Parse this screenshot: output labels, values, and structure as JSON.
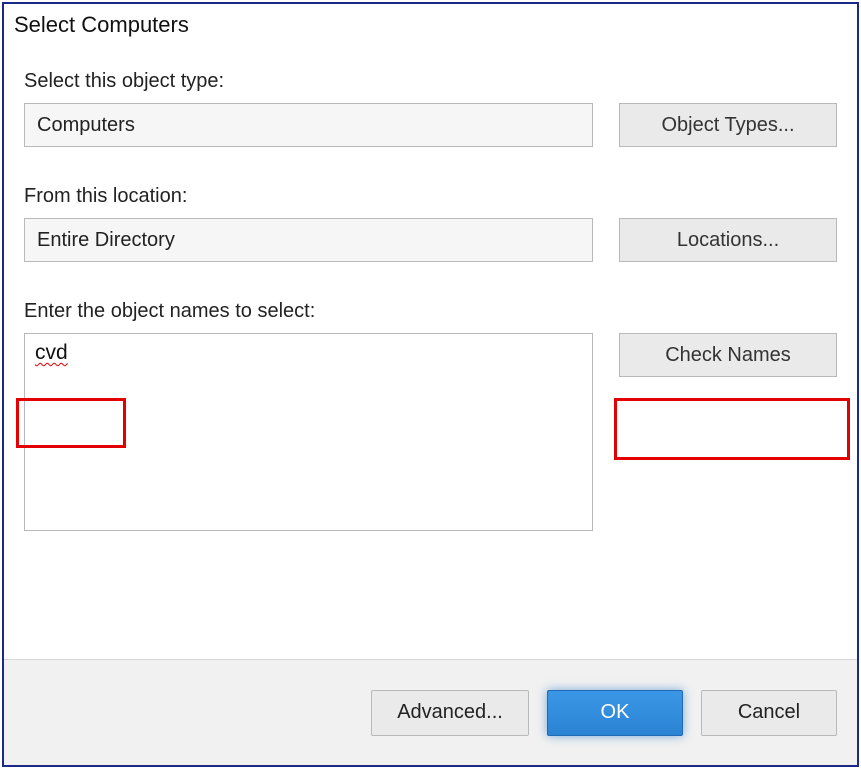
{
  "window": {
    "title": "Select Computers"
  },
  "labels": {
    "object_type": "Select this object type:",
    "location": "From this location:",
    "enter_names": "Enter the object names to select:"
  },
  "fields": {
    "object_type_value": "Computers",
    "location_value": "Entire Directory",
    "names_value": "cvd"
  },
  "buttons": {
    "object_types": "Object Types...",
    "locations": "Locations...",
    "check_names": "Check Names",
    "advanced": "Advanced...",
    "ok": "OK",
    "cancel": "Cancel"
  }
}
